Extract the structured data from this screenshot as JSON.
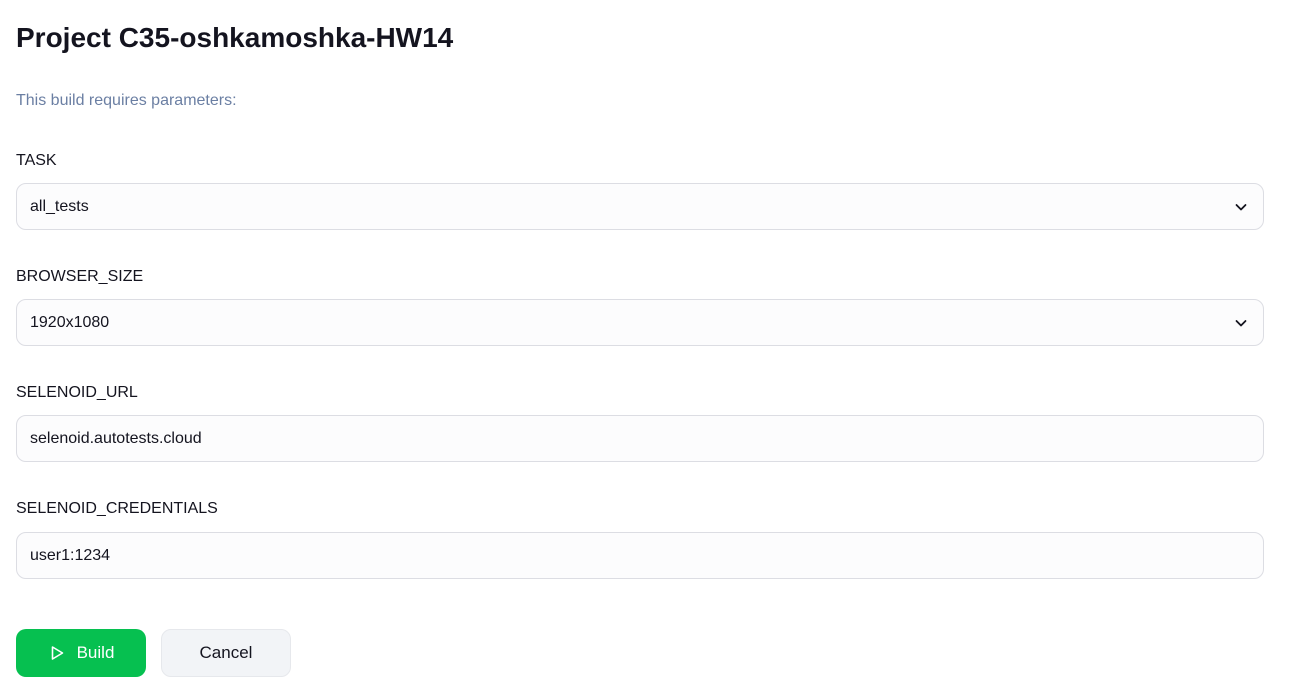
{
  "page": {
    "title": "Project C35-oshkamoshka-HW14",
    "subtitle": "This build requires parameters:"
  },
  "parameters": [
    {
      "label": "TASK",
      "value": "all_tests",
      "type": "select",
      "icon": "chevron-down-icon"
    },
    {
      "label": "BROWSER_SIZE",
      "value": "1920x1080",
      "type": "select",
      "icon": "chevron-down-icon"
    },
    {
      "label": "SELENOID_URL",
      "value": "selenoid.autotests.cloud",
      "type": "text"
    },
    {
      "label": "SELENOID_CREDENTIALS",
      "value": "user1:1234",
      "type": "text"
    }
  ],
  "actions": {
    "build_label": "Build",
    "build_icon": "play-icon",
    "cancel_label": "Cancel"
  },
  "colors": {
    "build_button": "#06c050",
    "cancel_button": "#f2f4f7",
    "subtitle_text": "#6b7fa3",
    "field_border": "#dcdde3"
  }
}
